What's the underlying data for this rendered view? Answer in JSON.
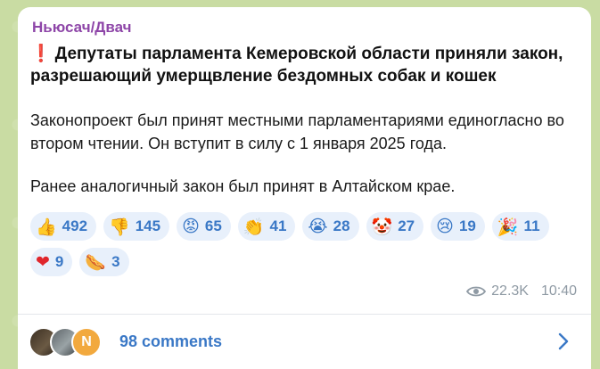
{
  "channel": "Ньюсач/Двач",
  "headline": {
    "mark": "❗",
    "text": "Депутаты парламента Кемеровской области приняли закон, разрешающий умерщвление бездомных собак и кошек"
  },
  "paragraphs": [
    "Законопроект был принят местными парламентариями единогласно во втором чтении. Он вступит в силу с 1 января 2025 года.",
    "Ранее аналогичный закон был принят в Алтайском крае."
  ],
  "reactions": [
    {
      "emoji": "👍",
      "icon": "thumbs-up-icon",
      "count": "492"
    },
    {
      "emoji": "👎",
      "icon": "thumbs-down-icon",
      "count": "145"
    },
    {
      "emoji": "😡",
      "icon": "angry-face-icon",
      "count": "65"
    },
    {
      "emoji": "👏",
      "icon": "clapping-hands-icon",
      "count": "41"
    },
    {
      "emoji": "😭",
      "icon": "crying-face-icon",
      "count": "28"
    },
    {
      "emoji": "🤡",
      "icon": "clown-face-icon",
      "count": "27"
    },
    {
      "emoji": "😢",
      "icon": "sad-tear-face-icon",
      "count": "19"
    },
    {
      "emoji": "🎉",
      "icon": "party-popper-icon",
      "count": "11"
    },
    {
      "emoji": "❤",
      "icon": "red-heart-icon",
      "count": "9"
    },
    {
      "emoji": "🌭",
      "icon": "hot-dog-icon",
      "count": "3"
    }
  ],
  "meta": {
    "views": "22.3K",
    "time": "10:40"
  },
  "comments": {
    "label": "98 comments",
    "avatar3_initial": "N"
  },
  "colors": {
    "channel": "#8e46a8",
    "accent": "#3a78c6",
    "chip_bg": "#e8f0fb",
    "background": "#c9dca3"
  }
}
